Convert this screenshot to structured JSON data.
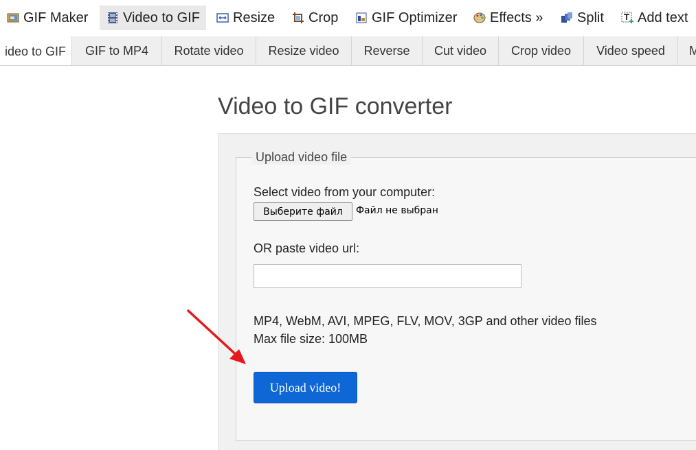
{
  "topnav": {
    "items": [
      {
        "label": "GIF Maker",
        "icon": "gif-maker-icon"
      },
      {
        "label": "Video to GIF",
        "icon": "film-icon",
        "active": true
      },
      {
        "label": "Resize",
        "icon": "resize-icon"
      },
      {
        "label": "Crop",
        "icon": "crop-icon"
      },
      {
        "label": "GIF Optimizer",
        "icon": "optimizer-icon"
      },
      {
        "label": "Effects »",
        "icon": "palette-icon"
      },
      {
        "label": "Split",
        "icon": "split-icon"
      },
      {
        "label": "Add text",
        "icon": "add-text-icon"
      }
    ]
  },
  "subtabs": {
    "items": [
      {
        "label": "ideo to GIF",
        "active": true
      },
      {
        "label": "GIF to MP4"
      },
      {
        "label": "Rotate video"
      },
      {
        "label": "Resize video"
      },
      {
        "label": "Reverse"
      },
      {
        "label": "Cut video"
      },
      {
        "label": "Crop video"
      },
      {
        "label": "Video speed"
      },
      {
        "label": "M"
      }
    ]
  },
  "main": {
    "title": "Video to GIF converter",
    "fieldset_legend": "Upload video file",
    "select_label": "Select video from your computer:",
    "file_button": "Выберите файл",
    "file_status": "Файл не выбран",
    "url_label": "OR paste video url:",
    "url_value": "",
    "formats_text": "MP4, WebM, AVI, MPEG, FLV, MOV, 3GP and other video files",
    "max_size_text": "Max file size: 100MB",
    "upload_button": "Upload video!"
  },
  "colors": {
    "accent": "#0f67d6",
    "annotation_arrow": "#e8171c"
  }
}
